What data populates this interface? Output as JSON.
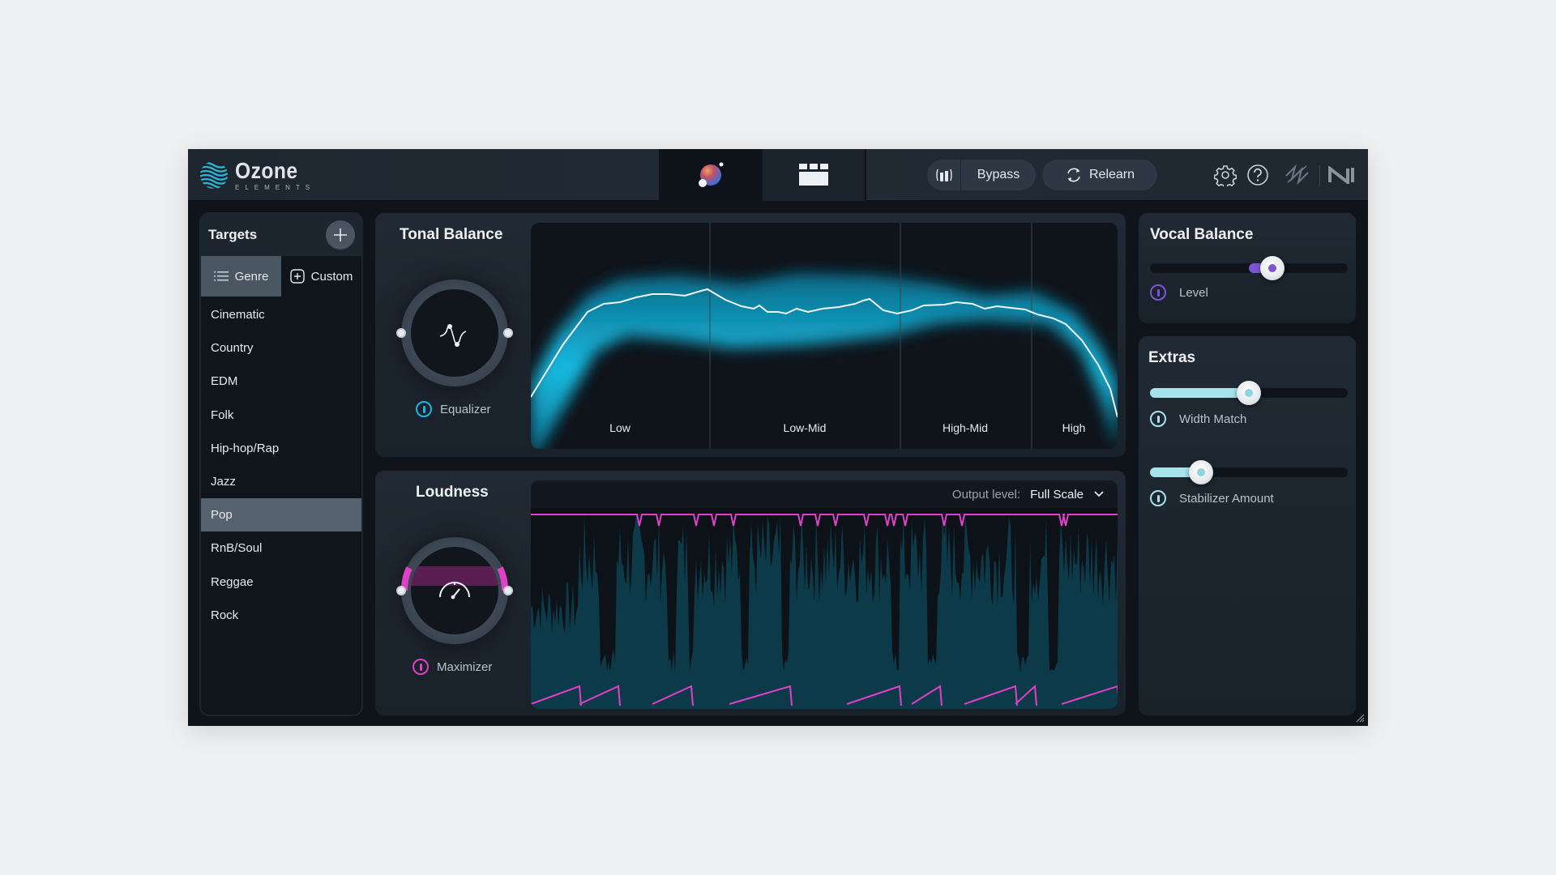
{
  "app": {
    "name": "Ozone",
    "edition": "ELEMENTS"
  },
  "header": {
    "tabs": [
      {
        "name": "assistant",
        "icon": "assistant-orb-icon",
        "active": true
      },
      {
        "name": "modules",
        "icon": "modules-grid-icon",
        "active": false
      }
    ],
    "bypass_label": "Bypass",
    "relearn_label": "Relearn",
    "icons": [
      "gear-icon",
      "help-icon",
      "izotope-logo-icon",
      "ni-logo-icon"
    ]
  },
  "targets": {
    "title": "Targets",
    "tabs": [
      {
        "label": "Genre",
        "icon": "list-icon",
        "active": true
      },
      {
        "label": "Custom",
        "icon": "add-square-icon",
        "active": false
      }
    ],
    "genres": [
      "Cinematic",
      "Country",
      "EDM",
      "Folk",
      "Hip-hop/Rap",
      "Jazz",
      "Pop",
      "RnB/Soul",
      "Reggae",
      "Rock"
    ],
    "selected": "Pop"
  },
  "tonal_balance": {
    "title": "Tonal Balance",
    "module_label": "Equalizer",
    "module_on": true,
    "accent": "#1ab8e0",
    "bands": [
      "Low",
      "Low-Mid",
      "High-Mid",
      "High"
    ]
  },
  "loudness": {
    "title": "Loudness",
    "module_label": "Maximizer",
    "module_on": true,
    "accent": "#e040c8",
    "output_level_label": "Output level:",
    "output_level_value": "Full Scale"
  },
  "vocal_balance": {
    "title": "Vocal Balance",
    "control_label": "Level",
    "accent": "#7d55d6",
    "value_percent": 62,
    "zero_percent": 50
  },
  "extras": {
    "title": "Extras",
    "accent": "#a6e3ec",
    "controls": [
      {
        "label": "Width Match",
        "value_percent": 50
      },
      {
        "label": "Stabilizer Amount",
        "value_percent": 26
      }
    ]
  }
}
